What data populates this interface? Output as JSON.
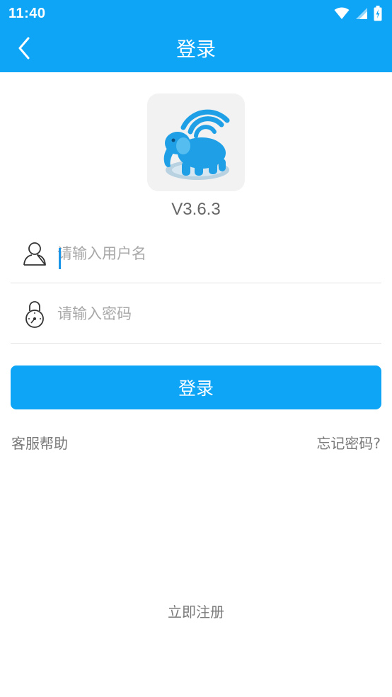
{
  "status_bar": {
    "time": "11:40"
  },
  "app_bar": {
    "title": "登录"
  },
  "app": {
    "version": "V3.6.3"
  },
  "form": {
    "username_placeholder": "请输入用户名",
    "username_value": "",
    "password_placeholder": "请输入密码",
    "password_value": "",
    "login_label": "登录"
  },
  "links": {
    "help": "客服帮助",
    "forgot": "忘记密码?",
    "register": "立即注册"
  },
  "icons": {
    "back": "chevron-left-icon",
    "user": "user-icon",
    "lock": "lock-icon",
    "wifi": "wifi-icon",
    "signal": "signal-icon",
    "battery": "battery-icon",
    "logo": "elephant-logo"
  },
  "colors": {
    "primary": "#0ea5f7",
    "logo_blue": "#1fa0e6",
    "text_muted": "#7a7a7a",
    "placeholder": "#a8a8a8"
  }
}
